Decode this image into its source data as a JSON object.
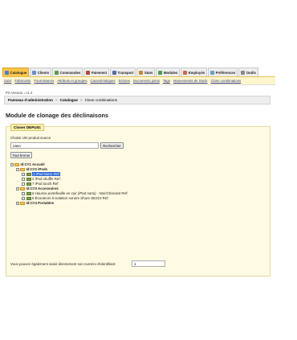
{
  "tabs": [
    {
      "label": "Catalogue",
      "icon": "catalog-icon",
      "color": "#4f7fc9",
      "active": true
    },
    {
      "label": "Clients",
      "icon": "clients-icon",
      "color": "#6b8fc9"
    },
    {
      "label": "Commandes",
      "icon": "orders-icon",
      "color": "#5a9a4b"
    },
    {
      "label": "Paiement",
      "icon": "payment-icon",
      "color": "#b04a3a"
    },
    {
      "label": "Transport",
      "icon": "shipping-icon",
      "color": "#5a6ea8"
    },
    {
      "label": "Stats",
      "icon": "stats-icon",
      "color": "#c9893a"
    },
    {
      "label": "Modules",
      "icon": "modules-icon",
      "color": "#4aa04a"
    },
    {
      "label": "Employés",
      "icon": "employees-icon",
      "color": "#c96b4a"
    },
    {
      "label": "Préférences",
      "icon": "preferences-icon",
      "color": "#6aa0c9"
    },
    {
      "label": "Outils",
      "icon": "tools-icon",
      "color": "#8a8a8a"
    }
  ],
  "subnav": [
    "Suivi",
    "Fabricants",
    "Fournisseurs",
    "Attributs et groupes",
    "Caractéristiques",
    "Scènes",
    "Documents joints",
    "Tags",
    "Mouvements de Stock",
    "Clone combinations"
  ],
  "version": "PS Version =>1.4",
  "breadcrumb": {
    "root": "Panneau d'administration",
    "sep": ">",
    "section": "Catalogue",
    "current": "Clone combinations"
  },
  "page_title": "Module de clonage des déclinaisons",
  "form": {
    "legend": "Cloner DEPUIS:",
    "source_label": "Choisir UN produit source",
    "search_value": "nano",
    "search_button": "Rechercher",
    "close_all_button": "Tout fermer",
    "id_label": "Vous pouvez également saisir directement son numéro d'identifiant:",
    "id_value": "1"
  },
  "tree": {
    "root": "Id:C#1 Accueil",
    "cat2": "Id:C#2 iPods",
    "p1": "1 iPod Nano Ref:",
    "p2": "2 iPod shuffle Ref:",
    "p7": "7 iPod touch Ref:",
    "cat3": "Id:C#3 Accessoires",
    "p6": "6 Housse portefeuille en cuir (iPod nano) - Noir/Chocolat Ref:",
    "p5": "5 Écouteurs à isolation sonore Shure SE210 Ref:",
    "cat4": "Id:C#4 Portables"
  }
}
